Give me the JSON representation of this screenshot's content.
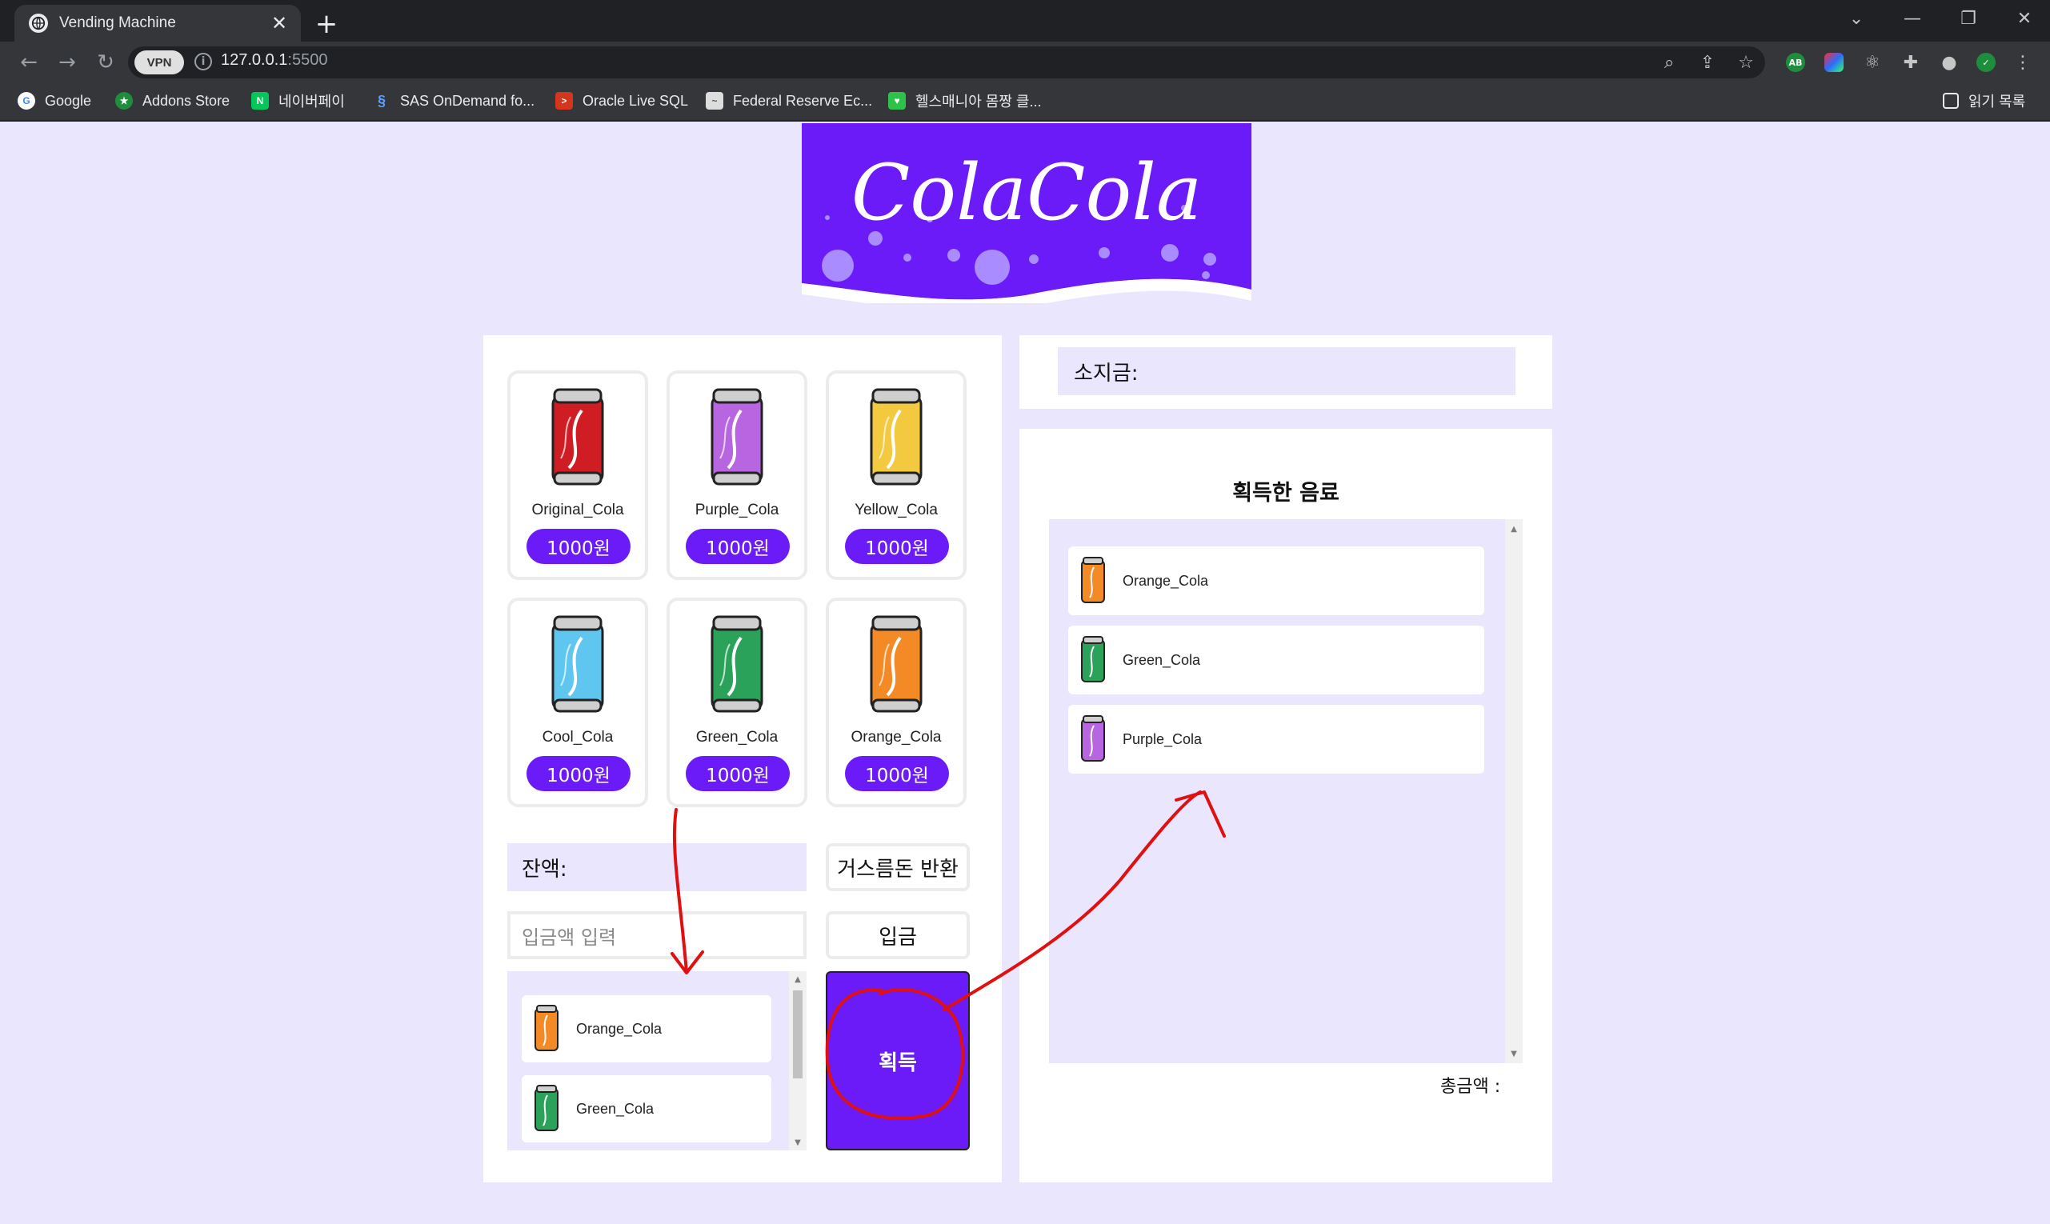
{
  "browser": {
    "tab_title": "Vending Machine",
    "url_host": "127.0.0.1",
    "url_port": ":5500",
    "vpn_label": "VPN",
    "bookmarks": [
      {
        "label": "Google"
      },
      {
        "label": "Addons Store"
      },
      {
        "label": "네이버페이"
      },
      {
        "label": "SAS OnDemand fo..."
      },
      {
        "label": "Oracle Live SQL"
      },
      {
        "label": "Federal Reserve Ec..."
      },
      {
        "label": "헬스매니아 몸짱 클..."
      }
    ],
    "reading_list": "읽기 목록",
    "extensions": [
      "AB"
    ]
  },
  "logo": {
    "text": "ColaCola"
  },
  "products": [
    {
      "name": "Original_Cola",
      "price": "1000원",
      "color": "#d01d23"
    },
    {
      "name": "Purple_Cola",
      "price": "1000원",
      "color": "#b765e0"
    },
    {
      "name": "Yellow_Cola",
      "price": "1000원",
      "color": "#f3c940"
    },
    {
      "name": "Cool_Cola",
      "price": "1000원",
      "color": "#5fc6f0"
    },
    {
      "name": "Green_Cola",
      "price": "1000원",
      "color": "#2aa25a"
    },
    {
      "name": "Orange_Cola",
      "price": "1000원",
      "color": "#f48a26"
    }
  ],
  "machine": {
    "balance_label": "잔액:",
    "change_button": "거스름돈 반환",
    "deposit_placeholder": "입금액 입력",
    "deposit_button": "입금",
    "get_button": "획득",
    "staged_items": [
      {
        "name": "Orange_Cola",
        "color": "#f48a26"
      },
      {
        "name": "Green_Cola",
        "color": "#2aa25a"
      }
    ]
  },
  "wallet": {
    "label": "소지금:"
  },
  "acquired": {
    "title": "획득한 음료",
    "items": [
      {
        "name": "Orange_Cola",
        "color": "#f48a26"
      },
      {
        "name": "Green_Cola",
        "color": "#2aa25a"
      },
      {
        "name": "Purple_Cola",
        "color": "#b765e0"
      }
    ],
    "total_label": "총금액 :"
  },
  "colors": {
    "accent": "#6a1bf7",
    "page_bg": "#e9e6fe",
    "annotation": "#e01010"
  }
}
